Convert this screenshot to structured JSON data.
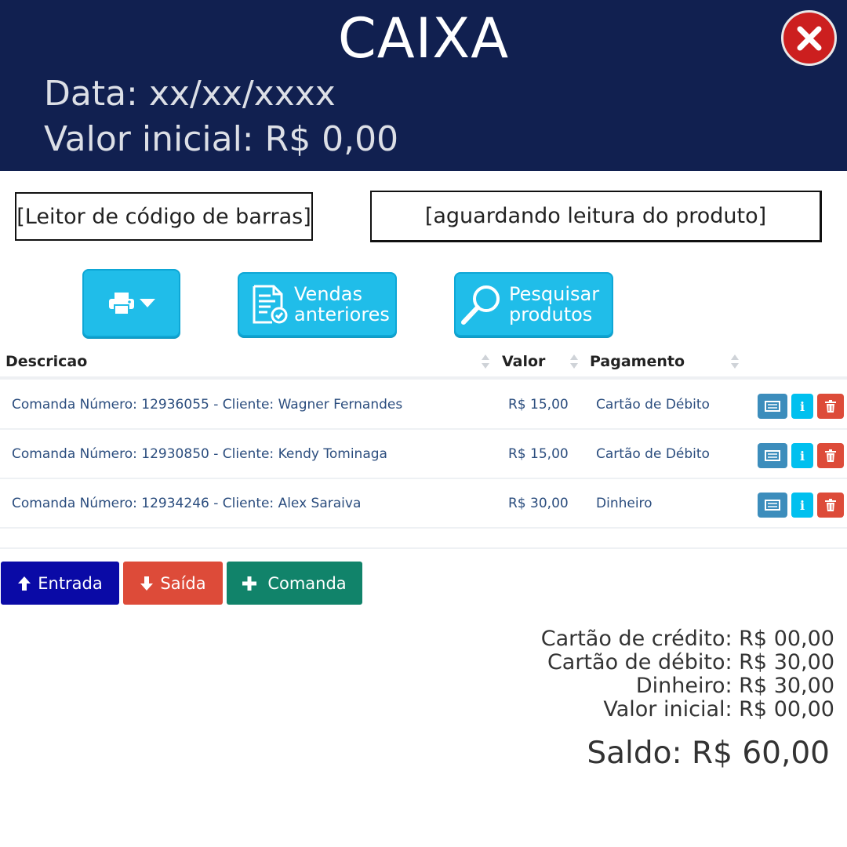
{
  "header": {
    "title": "CAIXA",
    "date_line": "Data: xx/xx/xxxx",
    "initial_value_line": "Valor inicial: R$ 0,00",
    "close_icon": "close-icon"
  },
  "barcode": {
    "label": "[Leitor de código de barras]",
    "status": "[aguardando leitura do produto]"
  },
  "toolbar": {
    "print_icon": "print-icon",
    "vendas_line1": "Vendas",
    "vendas_line2": "anteriores",
    "pesquisar_line1": "Pesquisar",
    "pesquisar_line2": "produtos"
  },
  "table": {
    "headers": [
      "Descricao",
      "Valor",
      "Pagamento"
    ],
    "rows": [
      {
        "descricao": "Comanda Número: 12936055 - Cliente: Wagner Fernandes",
        "valor": "R$ 15,00",
        "pagamento": "Cartão de Débito"
      },
      {
        "descricao": "Comanda Número: 12930850 - Cliente: Kendy Tominaga",
        "valor": "R$ 15,00",
        "pagamento": "Cartão de Débito"
      },
      {
        "descricao": "Comanda Número: 12934246 - Cliente: Alex Saraiva",
        "valor": "R$ 30,00",
        "pagamento": "Dinheiro"
      }
    ],
    "row_action_info_glyph": "i"
  },
  "actions": {
    "entrada": "Entrada",
    "saida": "Saída",
    "comanda": "Comanda"
  },
  "totals": {
    "credito": "Cartão de crédito: R$ 00,00",
    "debito": "Cartão de débito: R$ 30,00",
    "dinheiro": "Dinheiro: R$ 30,00",
    "valor_inicial": "Valor inicial: R$ 00,00",
    "saldo": "Saldo: R$ 60,00"
  },
  "colors": {
    "header_bg": "#112050",
    "accent": "#20bde9",
    "close": "#cc1f1f",
    "entrada": "#0a0aa6",
    "saida": "#dd4b39",
    "comanda": "#11836a"
  }
}
